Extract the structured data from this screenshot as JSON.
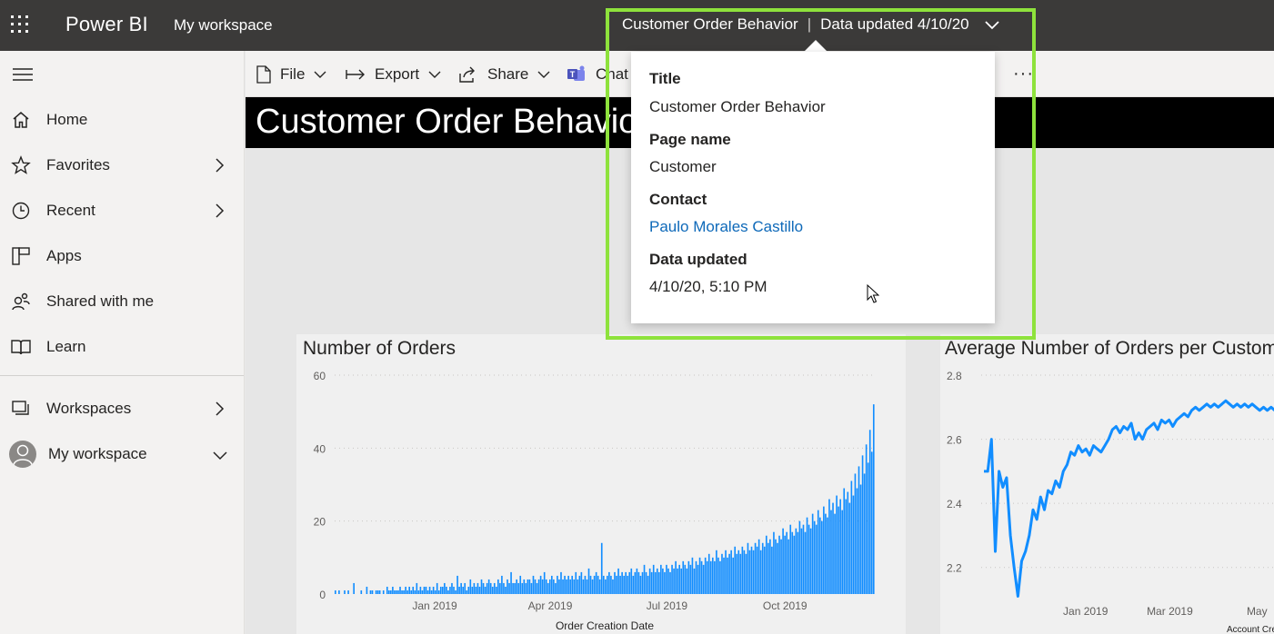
{
  "topbar": {
    "app_name": "Power BI",
    "workspace_crumb": "My workspace",
    "report_name": "Customer Order Behavior",
    "separator": "|",
    "data_updated_short": "Data updated 4/10/20"
  },
  "sidebar": {
    "items": [
      {
        "label": "Home",
        "icon": "home-icon"
      },
      {
        "label": "Favorites",
        "icon": "star-icon"
      },
      {
        "label": "Recent",
        "icon": "clock-icon"
      },
      {
        "label": "Apps",
        "icon": "apps-icon"
      },
      {
        "label": "Shared with me",
        "icon": "shared-icon"
      },
      {
        "label": "Learn",
        "icon": "book-icon"
      },
      {
        "label": "Workspaces",
        "icon": "workspaces-icon"
      },
      {
        "label": "My workspace",
        "icon": "avatar"
      }
    ]
  },
  "toolbar": {
    "file": "File",
    "export": "Export",
    "share": "Share",
    "chat": "Chat",
    "more": "···"
  },
  "report": {
    "title": "Customer Order Behavior"
  },
  "flyout": {
    "title_label": "Title",
    "title_value": "Customer Order Behavior",
    "page_label": "Page name",
    "page_value": "Customer",
    "contact_label": "Contact",
    "contact_value": "Paulo Morales Castillo",
    "updated_label": "Data updated",
    "updated_value": "4/10/20, 5:10 PM"
  },
  "colors": {
    "accent": "#118DFF",
    "highlight": "#8EE23C",
    "topbar": "#3B3A39",
    "link": "#0E69B9"
  },
  "chart_data": [
    {
      "type": "bar",
      "title": "Number of Orders",
      "xlabel": "Order Creation Date",
      "ylabel": "",
      "yticks": [
        "0",
        "20",
        "40",
        "60"
      ],
      "xticks": [
        "Jan 2019",
        "Apr 2019",
        "Jul 2019",
        "Oct 2019"
      ],
      "ylim": [
        0,
        60
      ],
      "x_range": [
        "2018-10-15",
        "2019-12-10"
      ],
      "grid": true,
      "values": [
        1,
        0,
        1,
        0,
        0,
        1,
        0,
        1,
        0,
        0,
        3,
        0,
        0,
        0,
        1,
        0,
        0,
        2,
        0,
        1,
        1,
        0,
        1,
        1,
        1,
        0,
        1,
        0,
        2,
        1,
        1,
        2,
        1,
        1,
        1,
        2,
        1,
        1,
        2,
        1,
        2,
        1,
        2,
        1,
        3,
        1,
        2,
        1,
        2,
        2,
        1,
        2,
        1,
        2,
        1,
        3,
        1,
        2,
        2,
        3,
        2,
        1,
        2,
        3,
        2,
        1,
        5,
        2,
        3,
        2,
        3,
        1,
        2,
        4,
        2,
        3,
        2,
        3,
        2,
        4,
        3,
        2,
        3,
        4,
        3,
        2,
        3,
        2,
        4,
        3,
        5,
        3,
        2,
        4,
        3,
        6,
        3,
        3,
        4,
        3,
        5,
        3,
        4,
        3,
        4,
        4,
        3,
        5,
        4,
        3,
        4,
        5,
        4,
        6,
        4,
        3,
        4,
        5,
        4,
        3,
        5,
        4,
        6,
        4,
        5,
        4,
        5,
        4,
        5,
        4,
        6,
        4,
        5,
        6,
        4,
        5,
        4,
        7,
        5,
        4,
        5,
        6,
        5,
        4,
        14,
        5,
        4,
        5,
        6,
        5,
        4,
        6,
        5,
        7,
        5,
        6,
        5,
        6,
        5,
        6,
        7,
        5,
        6,
        7,
        6,
        5,
        6,
        8,
        6,
        5,
        7,
        6,
        8,
        6,
        7,
        6,
        8,
        7,
        6,
        8,
        7,
        6,
        8,
        7,
        9,
        7,
        8,
        7,
        9,
        8,
        7,
        9,
        8,
        10,
        7,
        9,
        8,
        10,
        9,
        8,
        10,
        9,
        11,
        9,
        10,
        9,
        12,
        10,
        9,
        11,
        10,
        12,
        10,
        11,
        12,
        10,
        13,
        11,
        12,
        11,
        13,
        12,
        11,
        14,
        12,
        13,
        12,
        14,
        13,
        15,
        12,
        14,
        13,
        16,
        14,
        15,
        13,
        17,
        15,
        14,
        16,
        15,
        18,
        16,
        17,
        15,
        19,
        17,
        16,
        18,
        17,
        20,
        18,
        19,
        17,
        21,
        19,
        18,
        22,
        20,
        19,
        23,
        21,
        20,
        24,
        22,
        21,
        26,
        23,
        25,
        22,
        27,
        24,
        26,
        23,
        29,
        26,
        28,
        25,
        31,
        27,
        33,
        29,
        35,
        30,
        38,
        33,
        41,
        36,
        45,
        39,
        52
      ]
    },
    {
      "type": "line",
      "title": "Average Number of Orders per Customer",
      "xlabel": "Account Creation Date",
      "ylabel": "",
      "yticks": [
        "2.2",
        "2.4",
        "2.6",
        "2.8"
      ],
      "xticks": [
        "Jan 2019",
        "Mar 2019",
        "May"
      ],
      "ylim": [
        2.1,
        2.8
      ],
      "x_range": [
        "2018-10-20",
        "2019-06-01"
      ],
      "grid": true,
      "values": [
        2.5,
        2.5,
        2.6,
        2.25,
        2.5,
        2.45,
        2.48,
        2.3,
        2.2,
        2.11,
        2.22,
        2.25,
        2.3,
        2.38,
        2.35,
        2.42,
        2.38,
        2.44,
        2.43,
        2.47,
        2.45,
        2.5,
        2.52,
        2.56,
        2.55,
        2.58,
        2.56,
        2.57,
        2.55,
        2.58,
        2.57,
        2.56,
        2.58,
        2.6,
        2.63,
        2.64,
        2.62,
        2.64,
        2.63,
        2.65,
        2.6,
        2.62,
        2.6,
        2.63,
        2.64,
        2.65,
        2.63,
        2.66,
        2.65,
        2.66,
        2.64,
        2.66,
        2.67,
        2.68,
        2.67,
        2.69,
        2.7,
        2.69,
        2.7,
        2.71,
        2.7,
        2.71,
        2.7,
        2.71,
        2.72,
        2.71,
        2.7,
        2.71,
        2.7,
        2.71,
        2.7,
        2.71,
        2.7,
        2.69,
        2.7,
        2.69,
        2.7,
        2.69,
        2.7,
        2.69,
        2.7,
        2.69,
        2.7,
        2.69,
        2.7
      ]
    }
  ]
}
